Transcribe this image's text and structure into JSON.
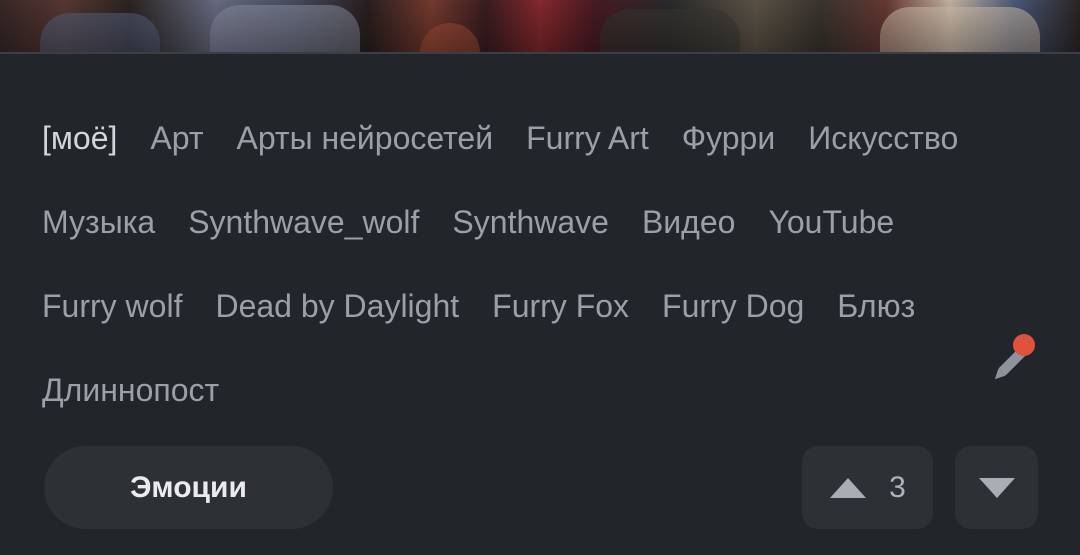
{
  "tags": [
    {
      "label": "[моё]",
      "active": true
    },
    {
      "label": "Арт"
    },
    {
      "label": "Арты нейросетей"
    },
    {
      "label": "Furry Art"
    },
    {
      "label": "Фурри"
    },
    {
      "label": "Искусство"
    },
    {
      "label": "Музыка"
    },
    {
      "label": "Synthwave_wolf"
    },
    {
      "label": "Synthwave"
    },
    {
      "label": "Видео"
    },
    {
      "label": "YouTube"
    },
    {
      "label": "Furry wolf"
    },
    {
      "label": "Dead by Daylight"
    },
    {
      "label": "Furry Fox"
    },
    {
      "label": "Furry Dog"
    },
    {
      "label": "Блюз"
    },
    {
      "label": "Длиннопост"
    }
  ],
  "actions": {
    "emotions_label": "Эмоции",
    "rating": "3"
  },
  "icons": {
    "edit": "pencil-icon",
    "edit_badge": "notification-dot",
    "upvote": "triangle-up-icon",
    "downvote": "triangle-down-icon"
  },
  "colors": {
    "background": "#22262b",
    "button": "#2d3136",
    "tag_text": "#9aa0a8",
    "badge": "#e0523d"
  }
}
